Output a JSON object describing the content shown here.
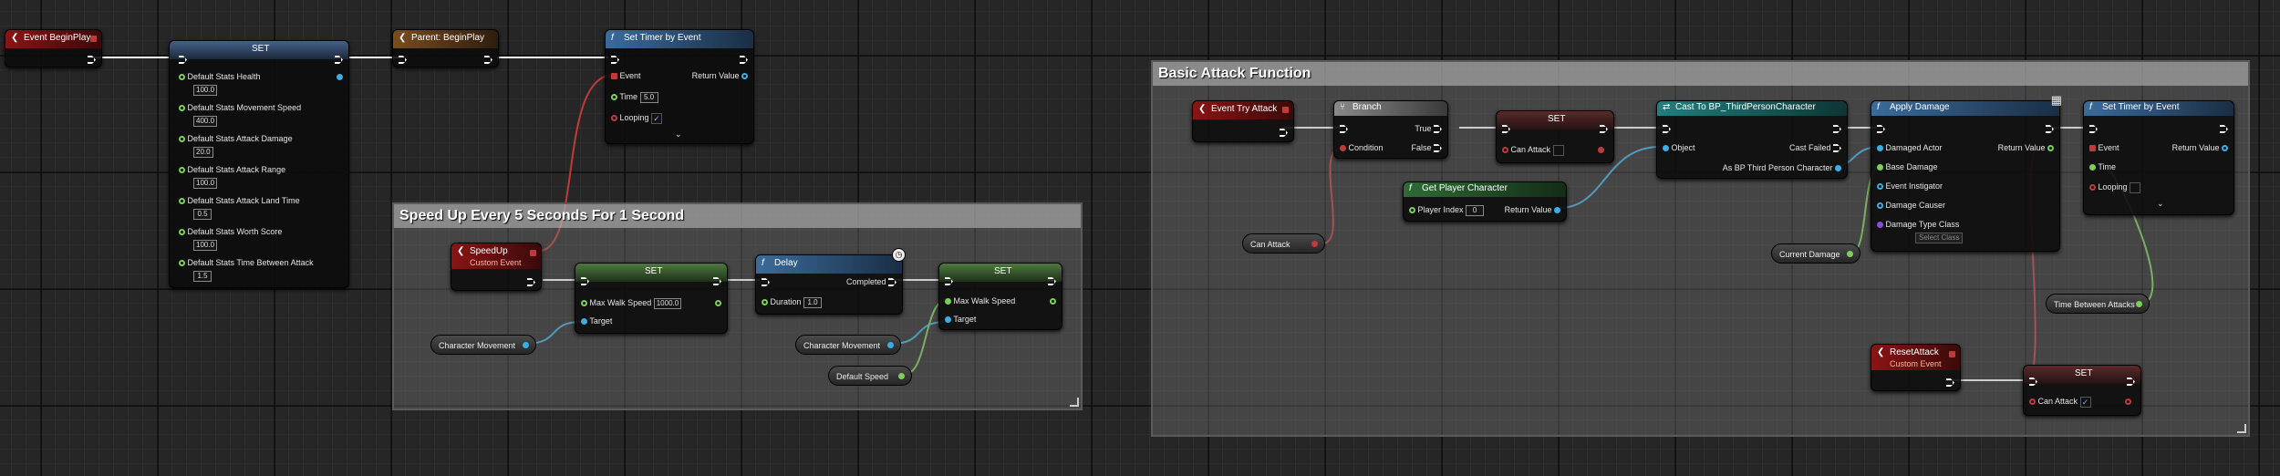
{
  "comments": {
    "speed": "Speed Up Every 5 Seconds For 1 Second",
    "attack": "Basic Attack Function"
  },
  "nodes": {
    "begin_play": {
      "title": "Event BeginPlay"
    },
    "set_defaults": {
      "title": "SET",
      "pins": [
        {
          "label": "Default Stats Health",
          "value": "100.0"
        },
        {
          "label": "Default Stats Movement Speed",
          "value": "400.0"
        },
        {
          "label": "Default Stats Attack Damage",
          "value": "20.0"
        },
        {
          "label": "Default Stats Attack Range",
          "value": "100.0"
        },
        {
          "label": "Default Stats Attack Land Time",
          "value": "0.5"
        },
        {
          "label": "Default Stats Worth Score",
          "value": "100.0"
        },
        {
          "label": "Default Stats Time Between Attack",
          "value": "1.5"
        }
      ]
    },
    "parent_begin": {
      "title": "Parent: BeginPlay"
    },
    "set_timer_1": {
      "title": "Set Timer by Event",
      "event": "Event",
      "return": "Return Value",
      "time": "Time",
      "time_value": "5.0",
      "looping": "Looping"
    },
    "speedup": {
      "title": "SpeedUp",
      "subtitle": "Custom Event"
    },
    "set_speed": {
      "title": "SET",
      "pin": "Max Walk Speed",
      "value": "1000.0",
      "target": "Target"
    },
    "delay": {
      "title": "Delay",
      "completed": "Completed",
      "duration": "Duration",
      "duration_value": "1.0"
    },
    "set_speed2": {
      "title": "SET",
      "pin": "Max Walk Speed",
      "target": "Target"
    },
    "try_attack": {
      "title": "Event Try Attack"
    },
    "branch": {
      "title": "Branch",
      "condition": "Condition",
      "true": "True",
      "false": "False"
    },
    "set_can_attack": {
      "title": "SET",
      "pin": "Can Attack"
    },
    "get_player": {
      "title": "Get Player Character",
      "index": "Player Index",
      "index_value": "0",
      "return": "Return Value"
    },
    "cast": {
      "title": "Cast To BP_ThirdPersonCharacter",
      "object": "Object",
      "failed": "Cast Failed",
      "as": "As BP Third Person Character"
    },
    "apply_damage": {
      "title": "Apply Damage",
      "pins": [
        "Damaged Actor",
        "Base Damage",
        "Event Instigator",
        "Damage Causer",
        "Damage Type Class"
      ],
      "return": "Return Value",
      "select": "Select Class"
    },
    "set_timer_2": {
      "title": "Set Timer by Event",
      "event": "Event",
      "return": "Return Value",
      "time": "Time",
      "looping": "Looping"
    },
    "reset_attack": {
      "title": "ResetAttack",
      "subtitle": "Custom Event"
    },
    "set_can_attack2": {
      "title": "SET",
      "pin": "Can Attack"
    }
  },
  "variables": {
    "char_move_1": "Character Movement",
    "char_move_2": "Character Movement",
    "default_speed": "Default Speed",
    "can_attack": "Can Attack",
    "current_damage": "Current Damage",
    "time_between": "Time Between Attacks"
  }
}
